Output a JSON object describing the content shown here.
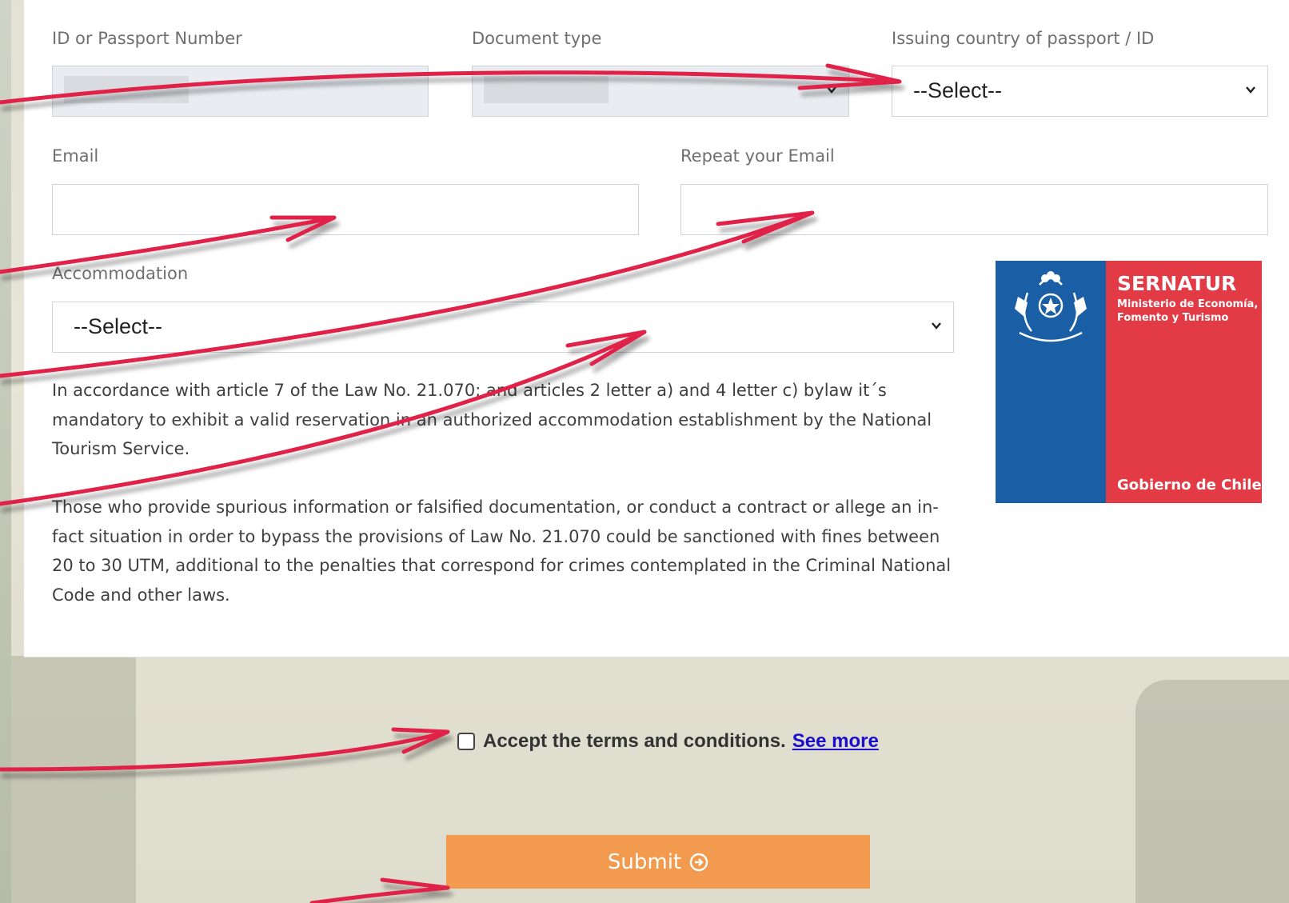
{
  "form": {
    "id_label": "ID or Passport Number",
    "doc_type_label": "Document type",
    "country_label": "Issuing country of passport / ID",
    "country_value": "--Select--",
    "email_label": "Email",
    "email_value": "",
    "repeat_email_label": "Repeat your Email",
    "repeat_email_value": "",
    "accommodation_label": "Accommodation",
    "accommodation_value": "--Select--"
  },
  "notice": {
    "paragraph1": "In accordance with article 7 of the Law No. 21.070; and articles 2 letter a) and 4 letter c) bylaw it´s mandatory to exhibit a valid reservation in an authorized accommodation establishment by the National Tourism Service.",
    "paragraph2": "Those who provide spurious information or falsified documentation, or conduct a contract or allege an in-fact situation in order to bypass the provisions of Law No. 21.070 could be sanctioned with fines between 20 to 30 UTM, additional to the penalties that correspond for crimes contemplated in the Criminal National Code and other laws."
  },
  "logo": {
    "brand": "SERNATUR",
    "ministry": "Ministerio de Economía, Fomento y Turismo",
    "government": "Gobierno de Chile"
  },
  "terms": {
    "text": "Accept the terms and conditions.",
    "link": "See more"
  },
  "submit": {
    "label": "Submit"
  },
  "colors": {
    "submit_bg": "#f29b4f",
    "annotation_arrow": "#e0224a",
    "logo_blue": "#1a5fa6",
    "logo_red": "#e23b45"
  }
}
